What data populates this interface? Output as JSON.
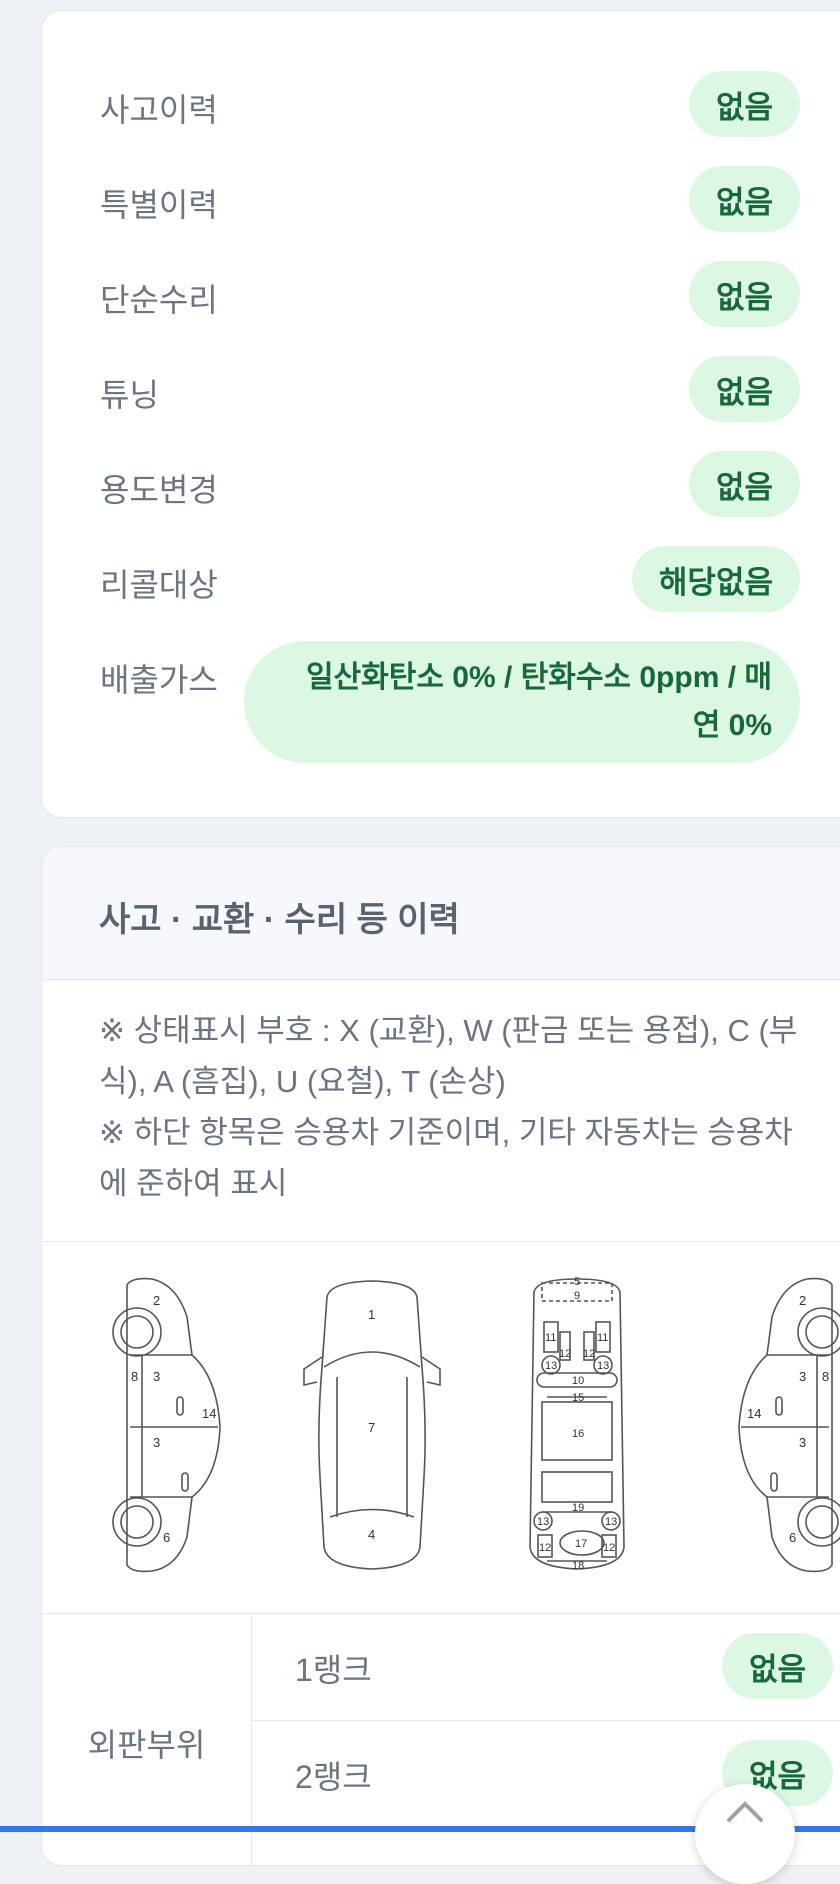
{
  "history": {
    "rows": [
      {
        "label": "사고이력",
        "value": "없음"
      },
      {
        "label": "특별이력",
        "value": "없음"
      },
      {
        "label": "단순수리",
        "value": "없음"
      },
      {
        "label": "튜닝",
        "value": "없음"
      },
      {
        "label": "용도변경",
        "value": "없음"
      },
      {
        "label": "리콜대상",
        "value": "해당없음"
      },
      {
        "label": "배출가스",
        "value_line1": "일산화탄소 0% / 탄화수소 0ppm / 매",
        "value_line2": "연 0%"
      }
    ]
  },
  "repair": {
    "title": "사고 · 교환 · 수리 등 이력",
    "note1_line1": "※ 상태표시 부호 : X (교환), W (판금 또는 용접), C (부",
    "note1_line2": "식), A (흠집), U (요철), T (손상)",
    "note2_line1": "※ 하단 항목은 승용차 기준이며, 기타 자동차는 승용차",
    "note2_line2": "에 준하여 표시",
    "diagram_numbers": {
      "left_side": [
        "2",
        "8",
        "3",
        "14",
        "3",
        "6"
      ],
      "front_top": [
        "1",
        "7",
        "4"
      ],
      "frame": [
        "5",
        "9",
        "11",
        "11",
        "12",
        "12",
        "13",
        "13",
        "10",
        "15",
        "16",
        "19",
        "13",
        "13",
        "12",
        "17",
        "12",
        "18"
      ],
      "right_side": [
        "2",
        "3",
        "8",
        "14",
        "3",
        "6"
      ]
    },
    "exterior": {
      "label": "외판부위",
      "ranks": [
        {
          "label": "1랭크",
          "value": "없음"
        },
        {
          "label": "2랭크",
          "value": "없음"
        }
      ]
    }
  },
  "colors": {
    "pill_bg": "#dcf8e5",
    "pill_text": "#17683a",
    "accent": "#2e7be6"
  }
}
